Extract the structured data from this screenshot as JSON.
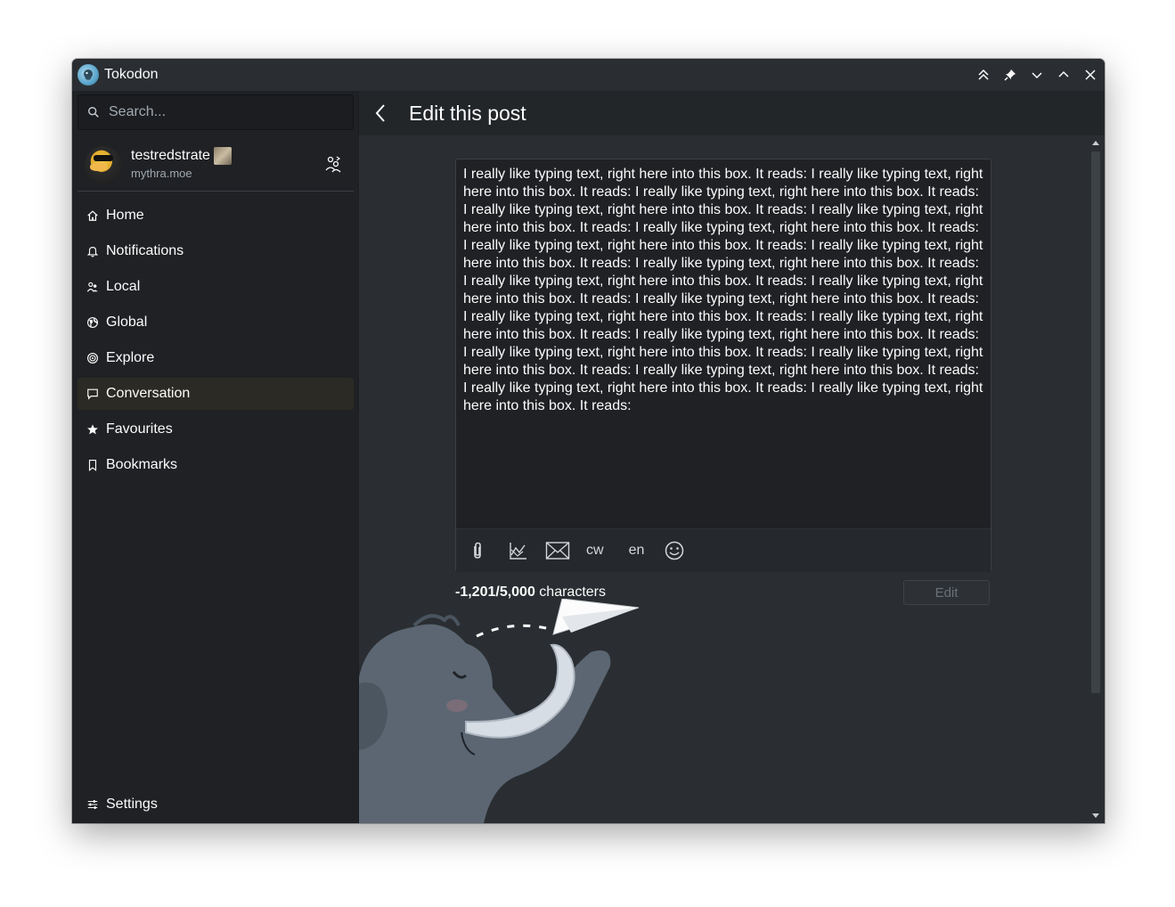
{
  "window": {
    "title": "Tokodon"
  },
  "titlebar_buttons": [
    "keep-above-icon",
    "pin-icon",
    "minimize-icon",
    "maximize-icon",
    "close-icon"
  ],
  "sidebar": {
    "search_placeholder": "Search...",
    "account": {
      "display_name": "testredstrate",
      "handle": "mythra.moe"
    },
    "items": [
      {
        "label": "Home",
        "icon": "home-icon",
        "active": false
      },
      {
        "label": "Notifications",
        "icon": "bell-icon",
        "active": false
      },
      {
        "label": "Local",
        "icon": "group-icon",
        "active": false
      },
      {
        "label": "Global",
        "icon": "globe-icon",
        "active": false
      },
      {
        "label": "Explore",
        "icon": "compass-icon",
        "active": false
      },
      {
        "label": "Conversation",
        "icon": "chat-icon",
        "active": true
      },
      {
        "label": "Favourites",
        "icon": "star-icon",
        "active": false
      },
      {
        "label": "Bookmarks",
        "icon": "bookmark-icon",
        "active": false
      }
    ],
    "settings_label": "Settings"
  },
  "page": {
    "title": "Edit this post"
  },
  "composer": {
    "text": "I really like typing text, right here into this box. It reads: I really like typing text, right here into this box. It reads: I really like typing text, right here into this box. It reads: I really like typing text, right here into this box. It reads: I really like typing text, right here into this box. It reads: I really like typing text, right here into this box. It reads: I really like typing text, right here into this box. It reads: I really like typing text, right here into this box. It reads: I really like typing text, right here into this box. It reads: I really like typing text, right here into this box. It reads: I really like typing text, right here into this box. It reads: I really like typing text, right here into this box. It reads: I really like typing text, right here into this box. It reads: I really like typing text, right here into this box. It reads: I really like typing text, right here into this box. It reads: I really like typing text, right here into this box. It reads: I really like typing text, right here into this box. It reads: I really like typing text, right here into this box. It reads: I really like typing text, right here into this box. It reads: I really like typing text, right here into this box. It reads:",
    "toolbar": {
      "cw_label": "cw",
      "language_label": "en"
    },
    "char_count_value": "-1,201/5,000",
    "char_count_suffix": " characters",
    "edit_label": "Edit"
  },
  "colors": {
    "window_bg": "#232629",
    "sidebar_bg": "#1f2124",
    "content_bg": "#2a2e32",
    "active_item": "#2b2a24",
    "text": "#fcfcfc",
    "muted_text": "#a1a9b1"
  }
}
